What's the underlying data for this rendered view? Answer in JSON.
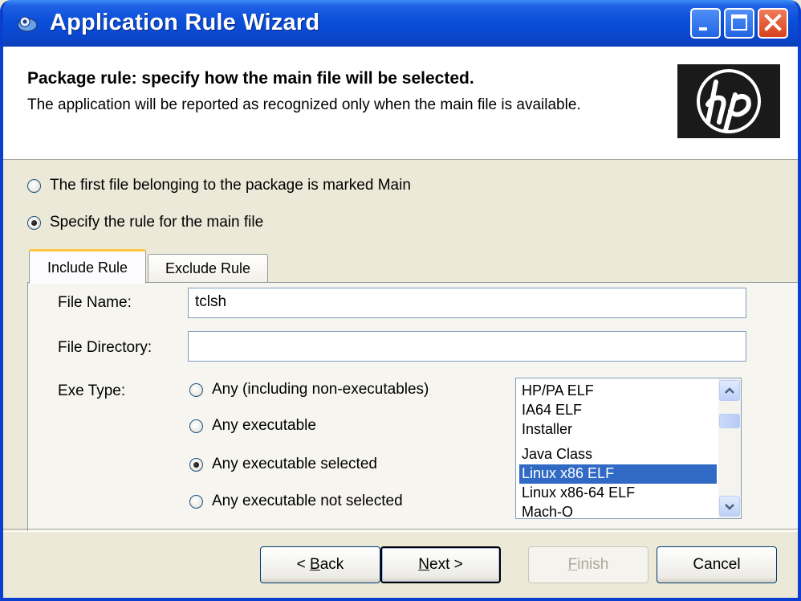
{
  "window": {
    "title": "Application Rule Wizard"
  },
  "header": {
    "title": "Package rule: specify how the main file will be selected.",
    "subtitle": "The application will be reported as recognized only when the main file is available.",
    "logo_text": "hp"
  },
  "options": {
    "first_file": "The first file belonging to the package is marked Main",
    "specify_rule": "Specify the rule for the main file",
    "selected": "specify_rule"
  },
  "tabs": [
    {
      "label": "Include Rule",
      "active": true
    },
    {
      "label": "Exclude Rule",
      "active": false
    }
  ],
  "form": {
    "file_name_label": "File Name:",
    "file_name_value": "tclsh",
    "file_directory_label": "File Directory:",
    "file_directory_value": "",
    "exe_type_label": "Exe Type:",
    "exe_options": [
      {
        "label": "Any (including non-executables)",
        "checked": false
      },
      {
        "label": "Any executable",
        "checked": false
      },
      {
        "label": "Any executable selected",
        "checked": true
      },
      {
        "label": "Any executable not selected",
        "checked": false
      }
    ],
    "exe_list": [
      "HP/PA ELF",
      "IA64 ELF",
      "Installer",
      "Java Class",
      "Linux x86 ELF",
      "Linux x86-64 ELF",
      "Mach-O"
    ],
    "exe_list_selected": "Linux x86 ELF"
  },
  "buttons": {
    "back": {
      "pre": "< ",
      "key": "B",
      "post": "ack"
    },
    "next": {
      "pre": "",
      "key": "N",
      "post": "ext >"
    },
    "finish": {
      "pre": "",
      "key": "F",
      "post": "inish"
    },
    "cancel": "Cancel"
  },
  "colors": {
    "titlebar": "#0b4fd9",
    "selection": "#316ac5",
    "window_bg": "#ece9d8"
  }
}
